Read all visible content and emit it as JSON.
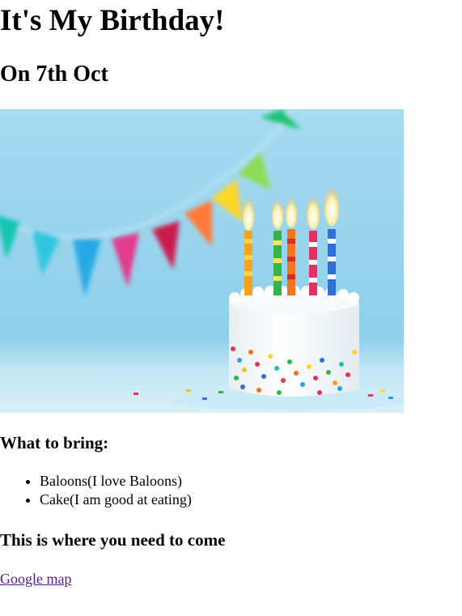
{
  "page": {
    "title": "It's My Birthday!",
    "date": "On 7th Oct"
  },
  "image": {
    "subject": "birthday-cake-with-candles",
    "colors": {
      "background": "#9fd6ef",
      "cake": "#ffffff",
      "link_visited": "#551a8b"
    }
  },
  "bring": {
    "heading": "What to bring:",
    "items": [
      "Baloons(I love Baloons)",
      "Cake(I am good at eating)"
    ]
  },
  "location": {
    "heading": "This is where you need to come",
    "link_text": "Google map"
  }
}
